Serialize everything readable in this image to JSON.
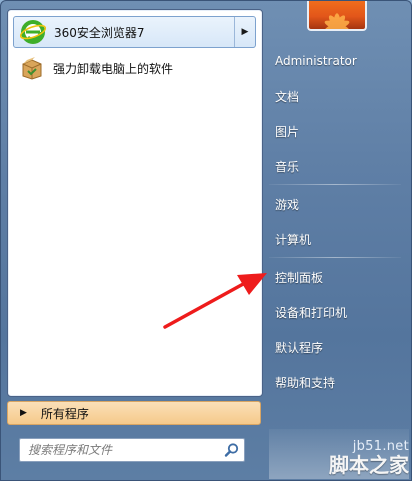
{
  "programs": [
    {
      "label": "360安全浏览器7",
      "icon": "browser-360-icon",
      "has_submenu": true
    },
    {
      "label": "强力卸载电脑上的软件",
      "icon": "uninstall-box-icon"
    }
  ],
  "all_programs": {
    "label": "所有程序"
  },
  "search": {
    "placeholder": "搜索程序和文件",
    "value": ""
  },
  "user": {
    "name": "Administrator",
    "picture": "flower-user-picture"
  },
  "right_items": [
    "文档",
    "图片",
    "音乐",
    "游戏",
    "计算机",
    "控制面板",
    "设备和打印机",
    "默认程序",
    "帮助和支持"
  ],
  "watermark": {
    "url": "jb51.net",
    "name": "脚本之家"
  },
  "colors": {
    "highlight": "#d7e7f8",
    "all_programs": "#f5c98b",
    "arrow": "#ee1c1c"
  }
}
